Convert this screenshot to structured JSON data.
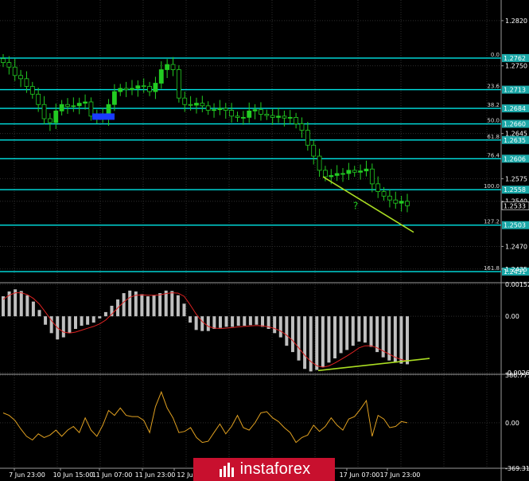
{
  "colors": {
    "background": "#000000",
    "grid": "#2e2e2e",
    "candles": "#22cc22",
    "fib_line": "#00e5e5",
    "trend_line": "#aadd22",
    "macd_hist": "#bfbfbf",
    "macd_signal": "#dd2222",
    "cci_line": "#e0a020",
    "logo_bg": "#c8102e"
  },
  "chart_data": [
    {
      "type": "candlestick",
      "panel": "price",
      "ylim": [
        1.2415,
        1.2852
      ],
      "y_ticks": [
        "1.2820",
        "1.2750",
        "1.2645",
        "1.2575",
        "1.2540",
        "1.2470",
        "1.2435"
      ],
      "x_tick_labels": [
        "7 Jun 23:00",
        "10 Jun 15:00",
        "11 Jun 07:00",
        "11 Jun 23:00",
        "12 Jun",
        "17 Jun 07:00",
        "17 Jun 23:00"
      ],
      "fib_levels": [
        {
          "label": "0.0",
          "price": "1.2762"
        },
        {
          "label": "23.6",
          "price": "1.2713"
        },
        {
          "label": "38.2",
          "price": "1.2684"
        },
        {
          "label": "50.0",
          "price": "1.2660"
        },
        {
          "label": "61.8",
          "price": "1.2635"
        },
        {
          "label": "76.4",
          "price": "1.2606"
        },
        {
          "label": "100.0",
          "price": "1.2558"
        },
        {
          "label": "127.2",
          "price": "1.2503"
        },
        {
          "label": "161.8",
          "price": "1.2431"
        }
      ],
      "current_price": "1.2533",
      "annotation": "?",
      "close_path": [
        1.2755,
        1.2748,
        1.2735,
        1.273,
        1.2718,
        1.2706,
        1.269,
        1.2668,
        1.2662,
        1.268,
        1.269,
        1.2687,
        1.2688,
        1.2692,
        1.2694,
        1.2672,
        1.2672,
        1.267,
        1.269,
        1.271,
        1.2715,
        1.2713,
        1.2715,
        1.2719,
        1.2718,
        1.271,
        1.2723,
        1.2744,
        1.2752,
        1.2744,
        1.27,
        1.269,
        1.2689,
        1.2692,
        1.2688,
        1.2681,
        1.2682,
        1.2684,
        1.2681,
        1.2672,
        1.267,
        1.267,
        1.268,
        1.2682,
        1.2675,
        1.2673,
        1.267,
        1.2672,
        1.2669,
        1.267,
        1.266,
        1.265,
        1.2627,
        1.261,
        1.2588,
        1.2578,
        1.258,
        1.2583,
        1.2583,
        1.2588,
        1.2585,
        1.2587,
        1.259,
        1.2567,
        1.2555,
        1.2548,
        1.2542,
        1.2537,
        1.254,
        1.2533
      ]
    },
    {
      "type": "bar",
      "panel": "macd",
      "ylim": [
        -0.00268,
        0.00152
      ],
      "y_ticks": [
        "0.00152",
        "0.00",
        "-0.00268"
      ],
      "hist_values": [
        0.00095,
        0.00118,
        0.00128,
        0.0012,
        0.001,
        0.0007,
        0.0003,
        -0.0004,
        -0.0008,
        -0.0011,
        -0.001,
        -0.0008,
        -0.0006,
        -0.00045,
        -0.0004,
        -0.0003,
        -0.0001,
        0.0002,
        0.0005,
        0.0008,
        0.0011,
        0.00122,
        0.00118,
        0.00105,
        0.00095,
        0.001,
        0.0011,
        0.00122,
        0.0012,
        0.001,
        0.0006,
        -0.0003,
        -0.00065,
        -0.0007,
        -0.0007,
        -0.0006,
        -0.00055,
        -0.0005,
        -0.0005,
        -0.00045,
        -0.00045,
        -0.00042,
        -0.0004,
        -0.0005,
        -0.0006,
        -0.0008,
        -0.001,
        -0.0014,
        -0.0017,
        -0.0021,
        -0.0025,
        -0.00262,
        -0.00255,
        -0.0024,
        -0.0022,
        -0.002,
        -0.00175,
        -0.0016,
        -0.0014,
        -0.0012,
        -0.00125,
        -0.00145,
        -0.0017,
        -0.00195,
        -0.0021,
        -0.0022,
        -0.00225,
        -0.00228
      ],
      "signal_values": [
        0.0008,
        0.001,
        0.00112,
        0.00112,
        0.00103,
        0.00085,
        0.00058,
        0.0002,
        -0.0002,
        -0.00055,
        -0.00075,
        -0.0008,
        -0.00075,
        -0.00066,
        -0.00057,
        -0.00048,
        -0.00036,
        -0.00018,
        0.0001,
        0.0004,
        0.00068,
        0.0009,
        0.001,
        0.00102,
        0.001,
        0.001,
        0.00102,
        0.00108,
        0.00112,
        0.0011,
        0.00095,
        0.00055,
        0.0001,
        -0.00025,
        -0.00048,
        -0.00056,
        -0.00058,
        -0.00056,
        -0.00054,
        -0.0005,
        -0.00048,
        -0.00046,
        -0.00044,
        -0.00046,
        -0.0005,
        -0.00058,
        -0.0007,
        -0.0009,
        -0.00115,
        -0.0015,
        -0.00185,
        -0.00215,
        -0.00235,
        -0.00242,
        -0.00236,
        -0.00222,
        -0.00205,
        -0.00188,
        -0.0017,
        -0.0015,
        -0.0014,
        -0.0014,
        -0.0015,
        -0.00165,
        -0.0018,
        -0.00195,
        -0.00205,
        -0.00212
      ]
    },
    {
      "type": "line",
      "panel": "cci",
      "ylim": [
        -369.317,
        386.777
      ],
      "y_ticks": [
        "386.777",
        "0.00",
        "-369.317"
      ],
      "values": [
        80,
        60,
        20,
        -50,
        -110,
        -140,
        -90,
        -120,
        -100,
        -60,
        -110,
        -60,
        -30,
        -80,
        40,
        -60,
        -110,
        -20,
        100,
        60,
        120,
        60,
        50,
        50,
        20,
        -80,
        130,
        250,
        120,
        40,
        -80,
        -70,
        -40,
        -120,
        -160,
        -150,
        -80,
        -10,
        -90,
        -30,
        60,
        -40,
        -60,
        0,
        80,
        90,
        40,
        10,
        -40,
        -80,
        -160,
        -120,
        -100,
        -20,
        -70,
        -30,
        40,
        -20,
        -60,
        30,
        50,
        110,
        180,
        -110,
        60,
        30,
        -40,
        -30,
        10,
        0
      ]
    }
  ]
}
